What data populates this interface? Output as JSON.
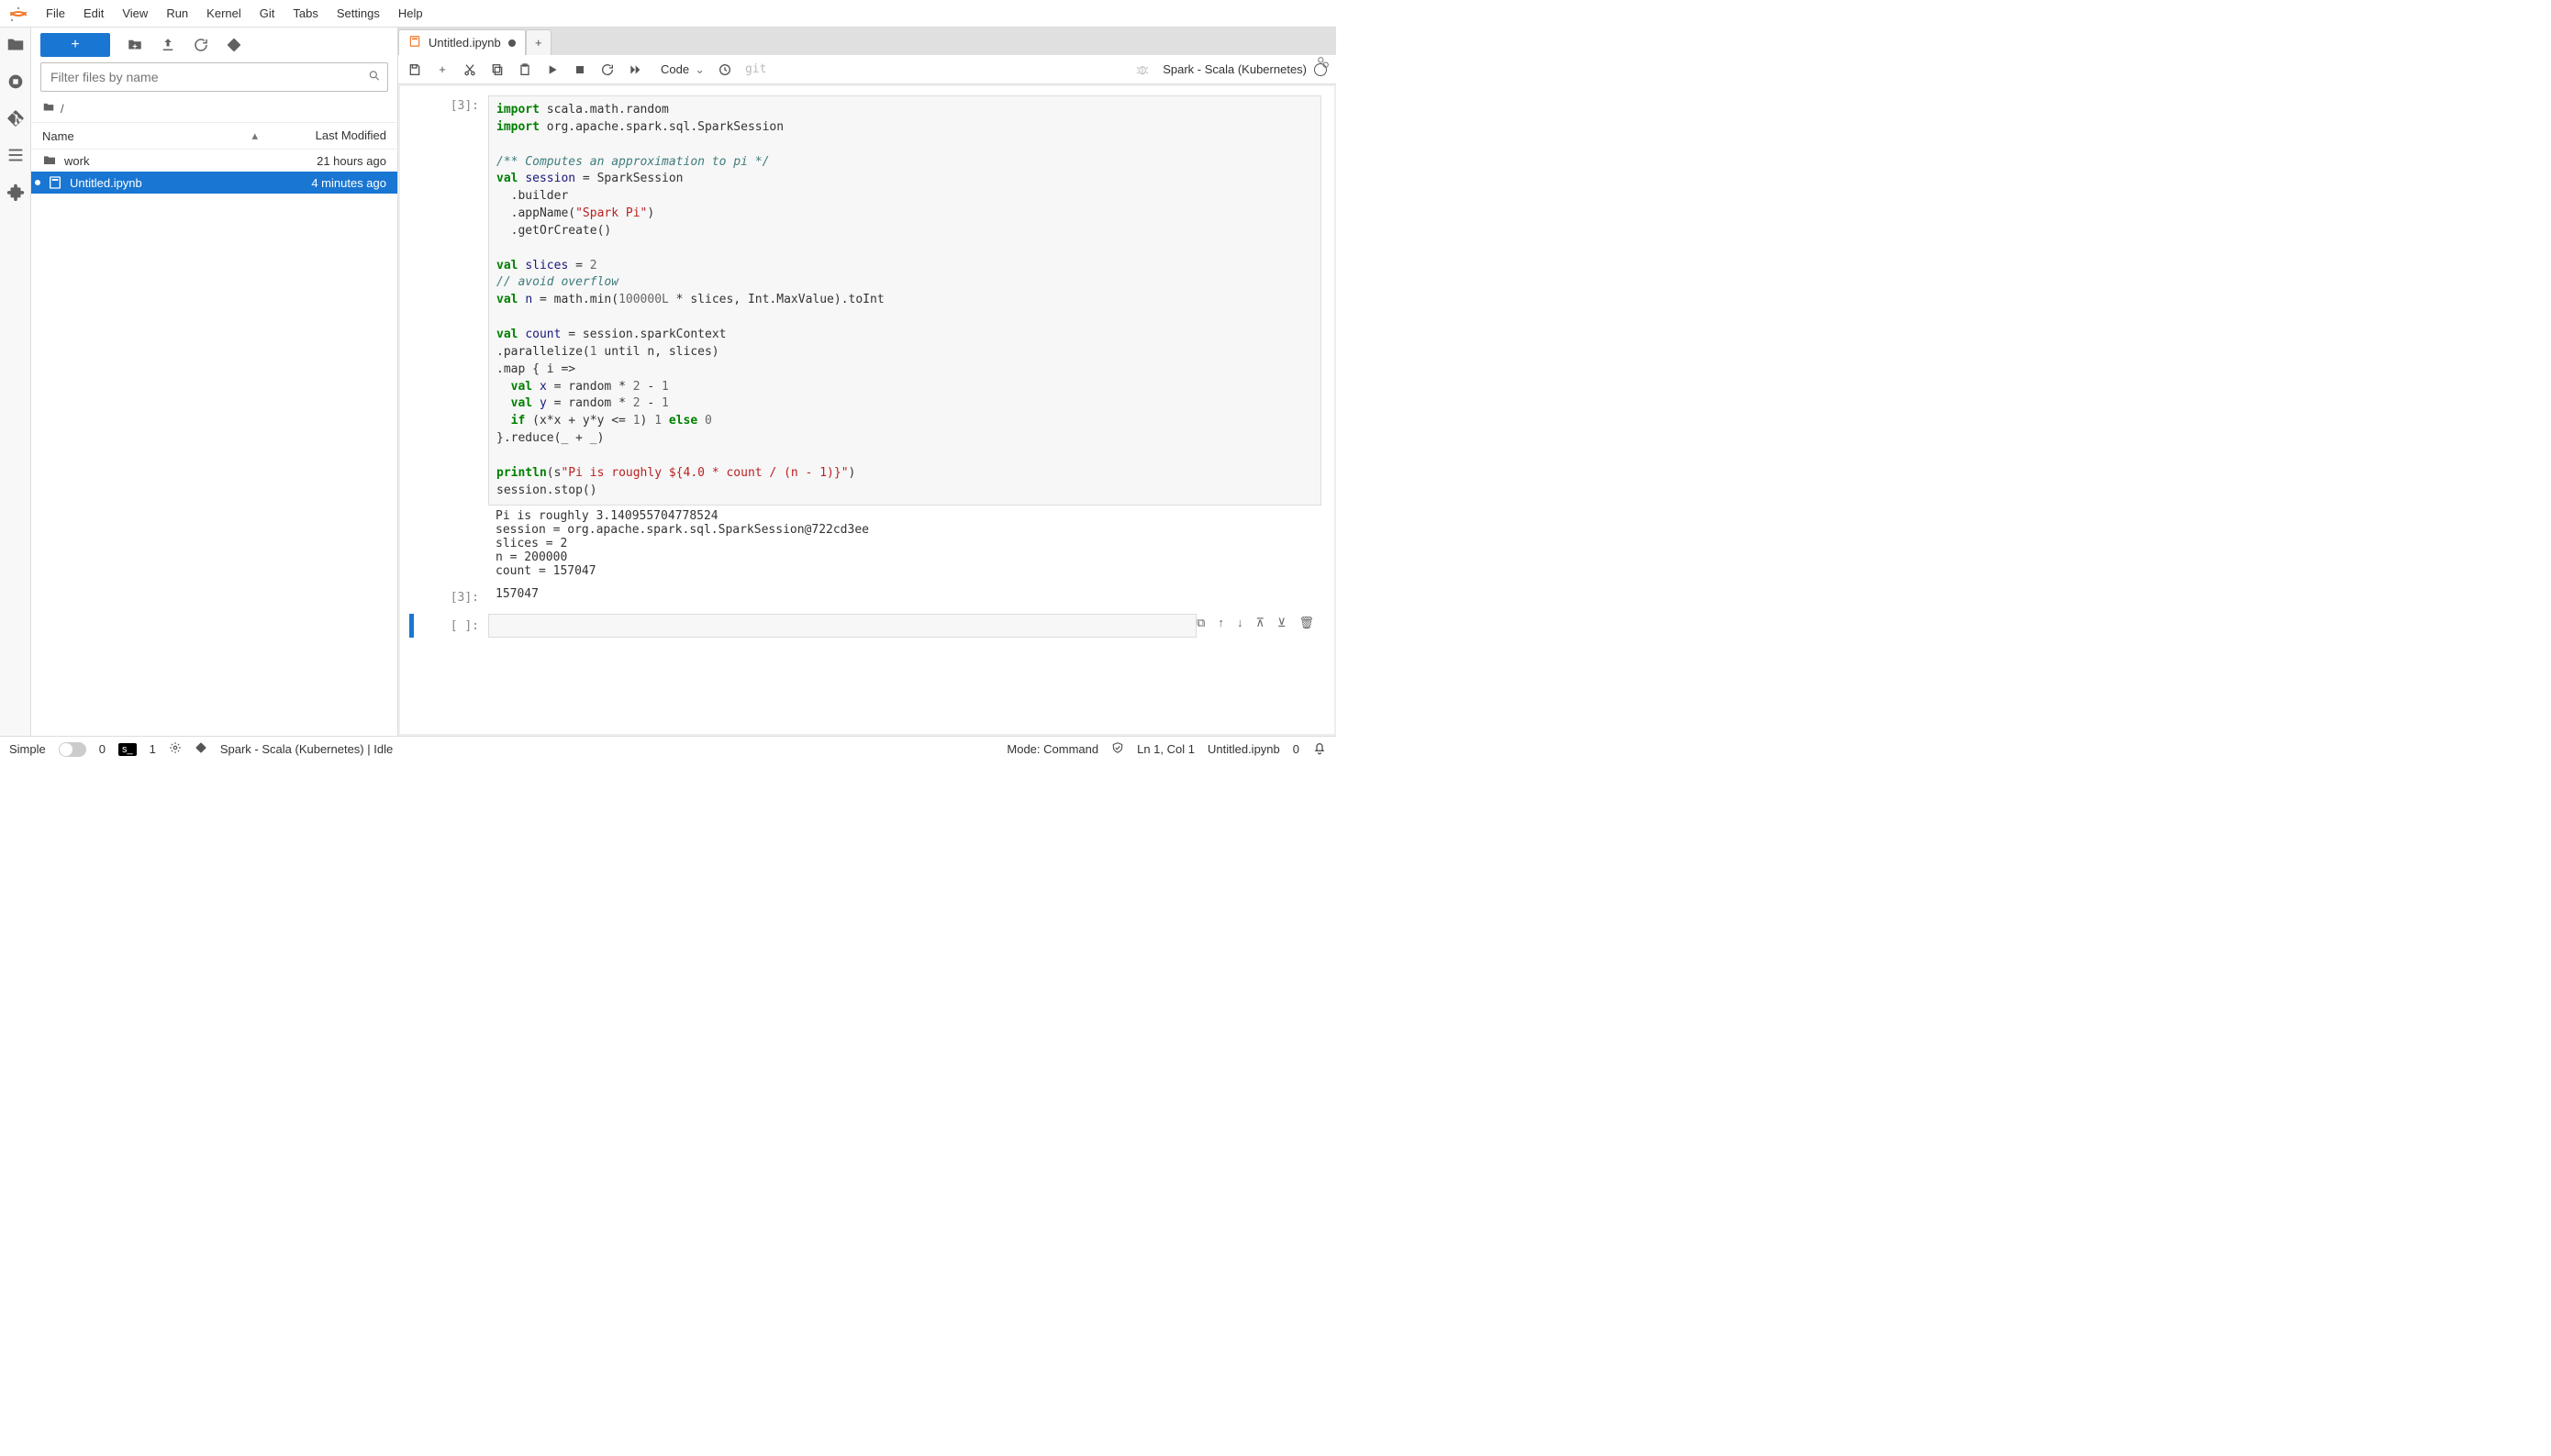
{
  "menu": {
    "items": [
      "File",
      "Edit",
      "View",
      "Run",
      "Kernel",
      "Git",
      "Tabs",
      "Settings",
      "Help"
    ]
  },
  "sidebar_icons": [
    "folder-icon",
    "circle-stop-icon",
    "git-branch-icon",
    "list-icon",
    "puzzle-icon"
  ],
  "filebrowser": {
    "filter_placeholder": "Filter files by name",
    "breadcrumb": "/",
    "columns": {
      "name": "Name",
      "modified": "Last Modified"
    },
    "rows": [
      {
        "type": "dir",
        "name": "work",
        "time": "21 hours ago",
        "selected": false,
        "running": false
      },
      {
        "type": "nb",
        "name": "Untitled.ipynb",
        "time": "4 minutes ago",
        "selected": true,
        "running": true
      }
    ]
  },
  "tab": {
    "title": "Untitled.ipynb",
    "dirty": true
  },
  "nbtoolbar": {
    "celltype": "Code",
    "git": "git",
    "kernel": "Spark - Scala (Kubernetes)"
  },
  "cell1": {
    "prompt": "[3]:",
    "code_lines": [
      [
        {
          "t": "import",
          "c": "kw"
        },
        {
          "t": " scala.math.random"
        }
      ],
      [
        {
          "t": "import",
          "c": "kw"
        },
        {
          "t": " org.apache.spark.sql.SparkSession"
        }
      ],
      [],
      [
        {
          "t": "/** Computes an approximation to pi */",
          "c": "cm"
        }
      ],
      [
        {
          "t": "val",
          "c": "kw"
        },
        {
          "t": " "
        },
        {
          "t": "session",
          "c": "nm"
        },
        {
          "t": " = SparkSession"
        }
      ],
      [
        {
          "t": "  .builder"
        }
      ],
      [
        {
          "t": "  .appName("
        },
        {
          "t": "\"Spark Pi\"",
          "c": "str"
        },
        {
          "t": ")"
        }
      ],
      [
        {
          "t": "  .getOrCreate()"
        }
      ],
      [],
      [
        {
          "t": "val",
          "c": "kw"
        },
        {
          "t": " "
        },
        {
          "t": "slices",
          "c": "nm"
        },
        {
          "t": " = "
        },
        {
          "t": "2",
          "c": "num"
        }
      ],
      [
        {
          "t": "// avoid overflow",
          "c": "cm"
        }
      ],
      [
        {
          "t": "val",
          "c": "kw"
        },
        {
          "t": " "
        },
        {
          "t": "n",
          "c": "nm"
        },
        {
          "t": " = math.min("
        },
        {
          "t": "100000L",
          "c": "num"
        },
        {
          "t": " * slices, Int.MaxValue).toInt"
        }
      ],
      [],
      [
        {
          "t": "val",
          "c": "kw"
        },
        {
          "t": " "
        },
        {
          "t": "count",
          "c": "nm"
        },
        {
          "t": " = session.sparkContext"
        }
      ],
      [
        {
          "t": ".parallelize("
        },
        {
          "t": "1",
          "c": "num"
        },
        {
          "t": " until n, slices)"
        }
      ],
      [
        {
          "t": ".map { i =>"
        }
      ],
      [
        {
          "t": "  "
        },
        {
          "t": "val",
          "c": "kw"
        },
        {
          "t": " "
        },
        {
          "t": "x",
          "c": "nm"
        },
        {
          "t": " = random * "
        },
        {
          "t": "2",
          "c": "num"
        },
        {
          "t": " - "
        },
        {
          "t": "1",
          "c": "num"
        }
      ],
      [
        {
          "t": "  "
        },
        {
          "t": "val",
          "c": "kw"
        },
        {
          "t": " "
        },
        {
          "t": "y",
          "c": "nm"
        },
        {
          "t": " = random * "
        },
        {
          "t": "2",
          "c": "num"
        },
        {
          "t": " - "
        },
        {
          "t": "1",
          "c": "num"
        }
      ],
      [
        {
          "t": "  "
        },
        {
          "t": "if",
          "c": "kw"
        },
        {
          "t": " (x*x + y*y <= "
        },
        {
          "t": "1",
          "c": "num"
        },
        {
          "t": ") "
        },
        {
          "t": "1",
          "c": "num"
        },
        {
          "t": " "
        },
        {
          "t": "else",
          "c": "kw"
        },
        {
          "t": " "
        },
        {
          "t": "0",
          "c": "num"
        }
      ],
      [
        {
          "t": "}.reduce(_ + _)"
        }
      ],
      [],
      [
        {
          "t": "println",
          "c": "kw"
        },
        {
          "t": "(s"
        },
        {
          "t": "\"Pi is roughly ${4.0 * count / (n - 1)}\"",
          "c": "str"
        },
        {
          "t": ")"
        }
      ],
      [
        {
          "t": "session.stop()"
        }
      ]
    ],
    "output": "Pi is roughly 3.140955704778524\nsession = org.apache.spark.sql.SparkSession@722cd3ee\nslices = 2\nn = 200000\ncount = 157047",
    "result_prompt": "[3]:",
    "result": "157047"
  },
  "cell2": {
    "prompt": "[ ]:"
  },
  "status": {
    "simple": "Simple",
    "count0": "0",
    "badge": "s_",
    "count1": "1",
    "kernel": "Spark - Scala (Kubernetes) | Idle",
    "mode": "Mode: Command",
    "cursor": "Ln 1, Col 1",
    "file": "Untitled.ipynb",
    "warn": "0"
  }
}
